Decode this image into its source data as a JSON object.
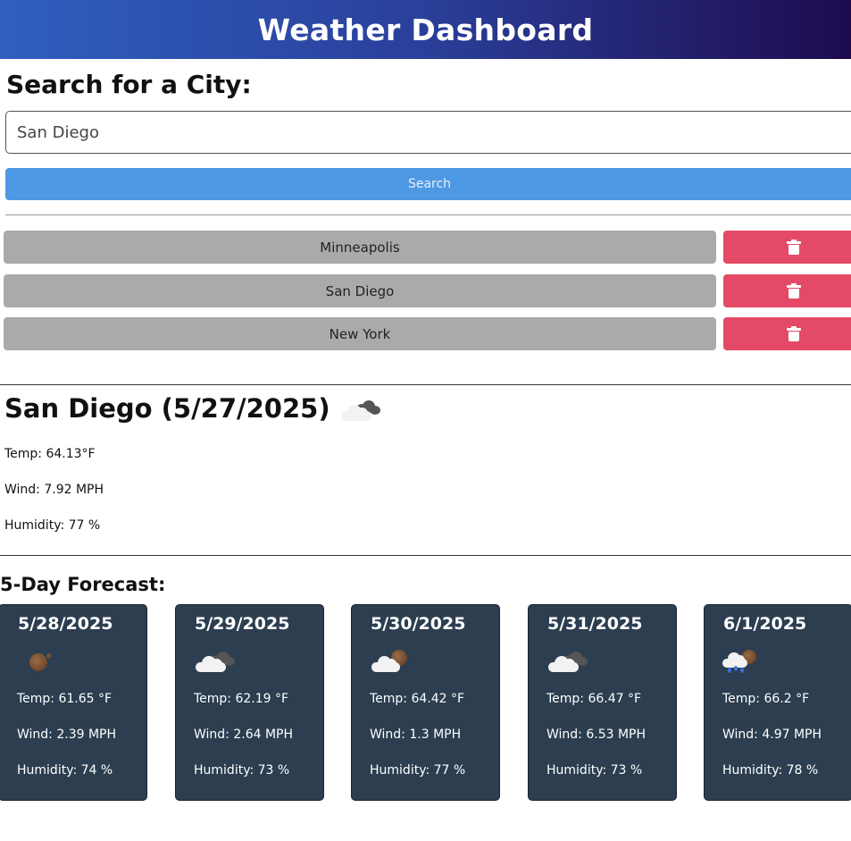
{
  "header": {
    "title": "Weather Dashboard"
  },
  "search": {
    "title": "Search for a City:",
    "input_value": "San Diego",
    "button_label": "Search"
  },
  "history": [
    {
      "city": "Minneapolis"
    },
    {
      "city": "San Diego"
    },
    {
      "city": "New York"
    }
  ],
  "current": {
    "heading": "San Diego (5/27/2025)",
    "icon": "broken-clouds-icon",
    "temp": "Temp: 64.13°F",
    "wind": "Wind: 7.92 MPH",
    "humidity": "Humidity: 77 %"
  },
  "forecast": {
    "title": "5-Day Forecast:",
    "days": [
      {
        "date": "5/28/2025",
        "icon": "clear-night-icon",
        "temp": "Temp: 61.65 °F",
        "wind": "Wind: 2.39 MPH",
        "humidity": "Humidity: 74 %"
      },
      {
        "date": "5/29/2025",
        "icon": "broken-clouds-icon",
        "temp": "Temp: 62.19 °F",
        "wind": "Wind: 2.64 MPH",
        "humidity": "Humidity: 73 %"
      },
      {
        "date": "5/30/2025",
        "icon": "few-clouds-night-icon",
        "temp": "Temp: 64.42 °F",
        "wind": "Wind: 1.3 MPH",
        "humidity": "Humidity: 77 %"
      },
      {
        "date": "5/31/2025",
        "icon": "broken-clouds-icon",
        "temp": "Temp: 66.47 °F",
        "wind": "Wind: 6.53 MPH",
        "humidity": "Humidity: 73 %"
      },
      {
        "date": "6/1/2025",
        "icon": "rain-night-icon",
        "temp": "Temp: 66.2 °F",
        "wind": "Wind: 4.97 MPH",
        "humidity": "Humidity: 78 %"
      }
    ]
  },
  "colors": {
    "header_start": "#2f5fbf",
    "header_end": "#1e0b4e",
    "search_button": "#4f98e3",
    "history_button": "#aaaaaa",
    "delete_button": "#e44a67",
    "forecast_card": "#2c3e50"
  }
}
